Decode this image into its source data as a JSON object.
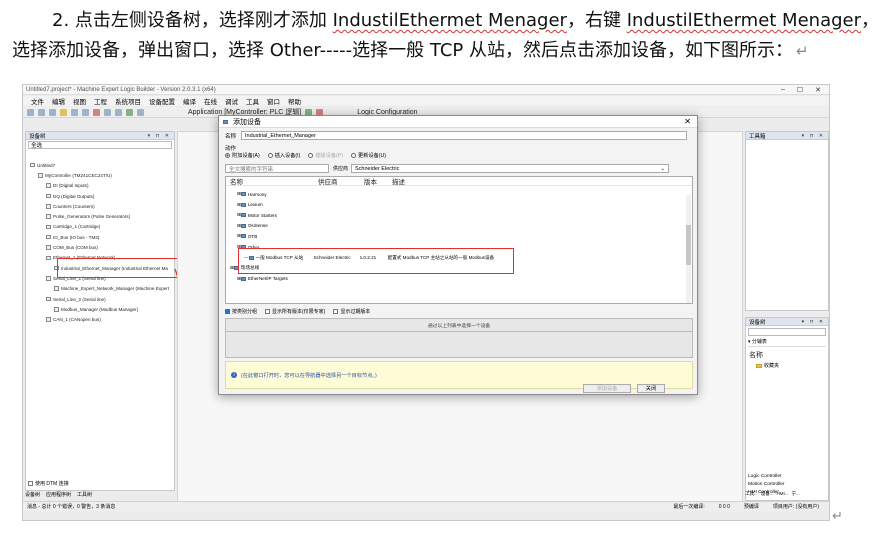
{
  "doc": {
    "line1_pre": "2. 点击左侧设备树，选择刚才添加 ",
    "line1_term1": "IndustilEthermet Menager",
    "line1_mid": "，右键 ",
    "line1_term2": "IndustilEthermet Menager",
    "line1_post": "，",
    "line2": "选择添加设备，弹出窗口，选择 Other-----选择一般 TCP 从站，然后点击添加设备，如下图所示：",
    "pilcrow": "↵"
  },
  "app": {
    "title": "Untitled7.project* - Machine Expert Logic Builder - Version 2.0.3.1 (x64)",
    "menu": [
      "文件",
      "编辑",
      "视图",
      "工程",
      "系统项目",
      "设备配置",
      "编译",
      "在线",
      "调试",
      "工具",
      "窗口",
      "帮助"
    ],
    "toolbar_app": "Application [MyController: PLC 逻辑]",
    "toolbar_logic": "Logic Configuration"
  },
  "left_panel": {
    "title": "设备树",
    "filter": "全选",
    "tree": [
      {
        "label": "Untitled7",
        "indent": 0
      },
      {
        "label": "MyController (TM241CEC24T/U)",
        "indent": 1
      },
      {
        "label": "DI (Digital Inputs)",
        "indent": 2
      },
      {
        "label": "DQ (Digital Outputs)",
        "indent": 2
      },
      {
        "label": "Counters (Counters)",
        "indent": 2
      },
      {
        "label": "Pulse_Generators (Pulse Generators)",
        "indent": 2
      },
      {
        "label": "Cartridge_1 (Cartridge)",
        "indent": 2
      },
      {
        "label": "IO_Bus (IO bus - TM3)",
        "indent": 2
      },
      {
        "label": "COM_Bus (COM bus)",
        "indent": 2
      },
      {
        "label": "Ethernet_1 (Ethernet Network)",
        "indent": 2
      },
      {
        "label": "Industrial_Ethernet_Manager (Industrial Ethernet Ma",
        "indent": 3
      },
      {
        "label": "Serial_Line_1 (Serial line)",
        "indent": 2
      },
      {
        "label": "Machine_Expert_Network_Manager (Machine Expert",
        "indent": 3
      },
      {
        "label": "Serial_Line_2 (Serial line)",
        "indent": 2
      },
      {
        "label": "Modbus_Manager (Modbus Manager)",
        "indent": 3
      },
      {
        "label": "CAN_1 (CANopen bus)",
        "indent": 2
      }
    ],
    "dtm_label": "使用 DTM 连接",
    "tabs": [
      "设备树",
      "应用程序树",
      "工具树"
    ]
  },
  "dialog": {
    "title": "添加设备",
    "name_label": "名称",
    "name_value": "Industrial_Ethernet_Manager",
    "action_label": "动作",
    "actions": [
      {
        "label": "附加设备(A)",
        "selected": true,
        "disabled": false
      },
      {
        "label": "插入设备(I)",
        "selected": false,
        "disabled": false
      },
      {
        "label": "插拔设备(P)",
        "selected": false,
        "disabled": true
      },
      {
        "label": "更新设备(U)",
        "selected": false,
        "disabled": false
      }
    ],
    "search_placeholder": "全文搜索的字符串",
    "vendor_label": "供应商",
    "vendor_value": "Schneider Electric",
    "columns": [
      "名称",
      "供应商",
      "版本",
      "描述"
    ],
    "devices": [
      {
        "label": "Harmony",
        "indent": 1
      },
      {
        "label": "Lexium",
        "indent": 1
      },
      {
        "label": "Motor Starters",
        "indent": 1
      },
      {
        "label": "OsiSense",
        "indent": 1
      },
      {
        "label": "OTB",
        "indent": 1
      },
      {
        "label": "Other",
        "indent": 1
      },
      {
        "label": "一般 Modbus TCP 从站",
        "indent": 2,
        "vendor": "Schneider Electric",
        "version": "1.0.2.21",
        "desc": "配置式 Modbus TCP 主站之从站的一般 Modbus设备"
      },
      {
        "label": "现场总线",
        "indent": 0
      },
      {
        "label": "EtherNet/IP Targets",
        "indent": 1
      }
    ],
    "checks": [
      {
        "label": "按类别分组",
        "checked": true
      },
      {
        "label": "显示所有版本(仅限专家)",
        "checked": false
      },
      {
        "label": "显示过期版本",
        "checked": false
      }
    ],
    "info_hint": "通过以上列表中选择一个设备",
    "note": "(在此窗口打开时，您可以在导航器中选择另一个目标节点。)",
    "add_button": "添加设备",
    "close_button": "关闭"
  },
  "right_panel": {
    "title": "工具箱",
    "lib_title": "设备树",
    "lib_cat": "分辅表",
    "lib_label": "名称",
    "lib_folder": "收藏夹",
    "lib_list": [
      "Logic Controller",
      "Motion Controller",
      "HMI Controller"
    ],
    "tabs": [
      "工具...",
      "设备...",
      "HMI...",
      "宁..."
    ]
  },
  "statusbar": {
    "left": "消息 - 总计 0 个错误，0 警告，3 条消息",
    "build": "最后一次编译:",
    "counts": "0  0  0",
    "precompile": "预编译",
    "user": "项目用户: (没有用户)"
  }
}
